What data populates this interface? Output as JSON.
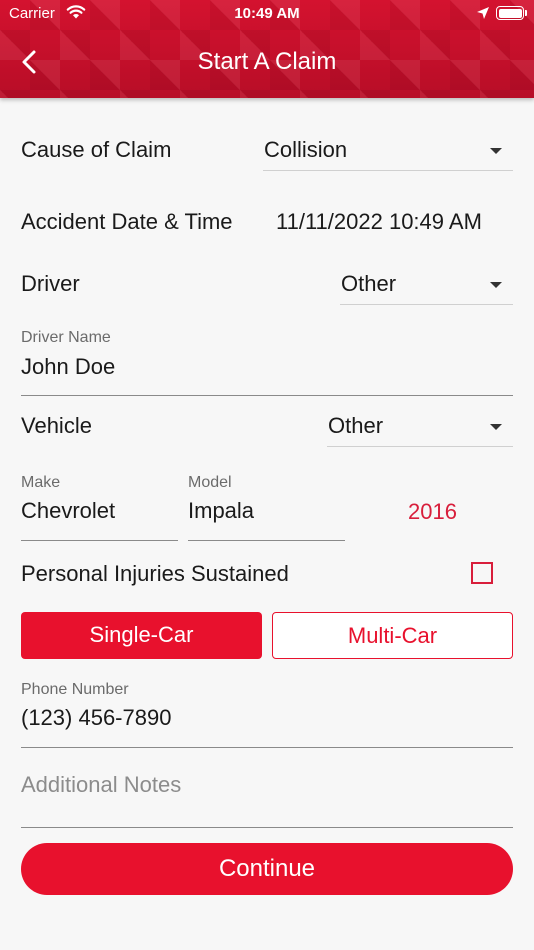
{
  "status_bar": {
    "carrier": "Carrier",
    "time": "10:49 AM"
  },
  "header": {
    "title": "Start A Claim"
  },
  "form": {
    "cause": {
      "label": "Cause of Claim",
      "value": "Collision"
    },
    "accident": {
      "label": "Accident Date & Time",
      "value": "11/11/2022 10:49 AM"
    },
    "driver": {
      "label": "Driver",
      "value": "Other"
    },
    "driver_name": {
      "label": "Driver Name",
      "value": "John Doe"
    },
    "vehicle": {
      "label": "Vehicle",
      "value": "Other"
    },
    "make": {
      "label": "Make",
      "value": "Chevrolet"
    },
    "model": {
      "label": "Model",
      "value": "Impala"
    },
    "year": "2016",
    "injuries": {
      "label": "Personal Injuries Sustained",
      "checked": false
    },
    "segments": {
      "single": "Single-Car",
      "multi": "Multi-Car",
      "selected": "Single-Car"
    },
    "phone": {
      "label": "Phone Number",
      "value": "(123) 456-7890"
    },
    "notes": {
      "placeholder": "Additional Notes"
    }
  },
  "actions": {
    "continue": "Continue"
  },
  "colors": {
    "brand": "#e8112d",
    "header": "#c8102e"
  }
}
